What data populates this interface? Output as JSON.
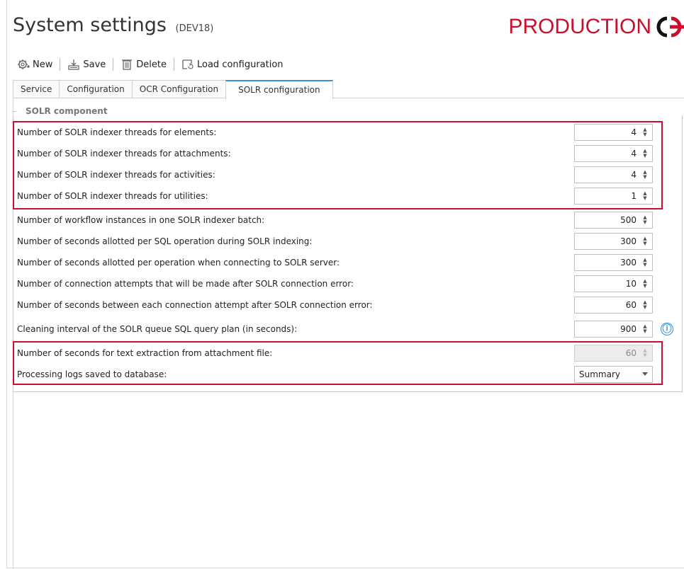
{
  "window": {
    "title": "System settings",
    "environment": "(DEV18)",
    "brand": "PRODUCTION"
  },
  "toolbar": {
    "new_label": "New",
    "save_label": "Save",
    "delete_label": "Delete",
    "load_label": "Load configuration"
  },
  "tabs": [
    {
      "label": "Service"
    },
    {
      "label": "Configuration"
    },
    {
      "label": "OCR Configuration"
    },
    {
      "label": "SOLR configuration",
      "active": true
    }
  ],
  "group": {
    "title": "SOLR component"
  },
  "rows": [
    {
      "label": "Number of SOLR indexer threads for elements:",
      "value": "4"
    },
    {
      "label": "Number of SOLR indexer threads for attachments:",
      "value": "4"
    },
    {
      "label": "Number of SOLR indexer threads for activities:",
      "value": "4"
    },
    {
      "label": "Number of SOLR indexer threads for utilities:",
      "value": "1"
    },
    {
      "label": "Number of workflow instances in one SOLR indexer batch:",
      "value": "500"
    },
    {
      "label": "Number of seconds allotted per SQL operation during SOLR indexing:",
      "value": "300"
    },
    {
      "label": "Number of seconds allotted per operation when connecting to SOLR server:",
      "value": "300"
    },
    {
      "label": "Number of connection attempts that will be made after SOLR connection error:",
      "value": "10"
    },
    {
      "label": "Number of seconds between each connection attempt after SOLR connection error:",
      "value": "60"
    },
    {
      "label": "Cleaning interval of the SOLR queue SQL query plan (in seconds):",
      "value": "900"
    },
    {
      "label": "Number of seconds for text extraction from attachment file:",
      "value": "60"
    },
    {
      "label": "Processing logs saved to database:",
      "value": "Summary"
    }
  ],
  "colors": {
    "highlight": "#c8102e",
    "brand": "#c8102e",
    "accent": "#3b8fd6",
    "info": "#2a8fd8"
  },
  "icons": {
    "info": "ⓘ"
  }
}
